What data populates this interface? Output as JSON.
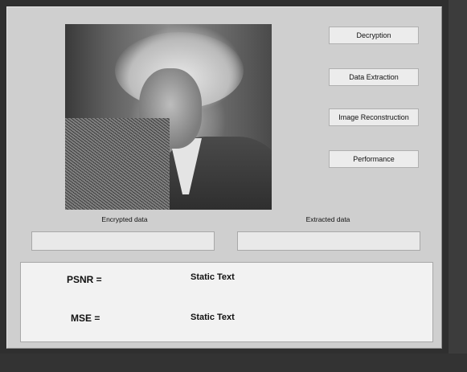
{
  "buttons": {
    "decryption": "Decryption",
    "data_extraction": "Data Extraction",
    "image_reconstruction": "Image Reconstruction",
    "performance": "Performance"
  },
  "labels": {
    "encrypted": "Encrypted data",
    "extracted": "Extracted data"
  },
  "fields": {
    "encrypted_value": "",
    "extracted_value": ""
  },
  "results": {
    "psnr_label": "PSNR =",
    "psnr_value": "Static Text",
    "mse_label": "MSE =",
    "mse_value": "Static Text"
  },
  "colors": {
    "panel": "#cfcfcf",
    "button": "#ececec",
    "results_bg": "#f2f2f2",
    "frame": "#2f2f2f"
  },
  "image": {
    "icon": "portrait-image",
    "overlay": "encrypted-noise-block"
  }
}
